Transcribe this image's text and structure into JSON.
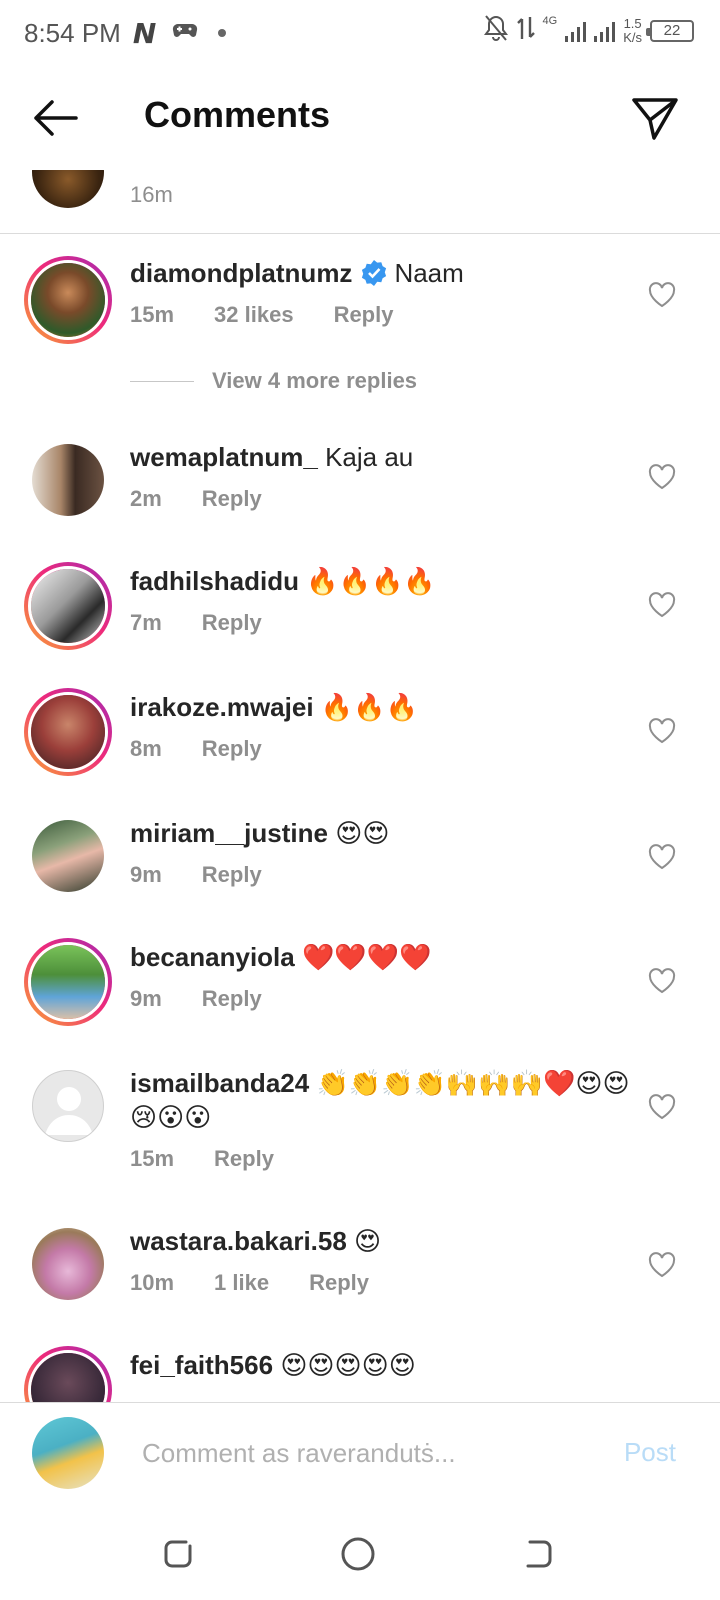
{
  "status": {
    "time": "8:54 PM",
    "app_badge": "N",
    "network": "4G",
    "speed_value": "1.5",
    "speed_unit": "K/s",
    "battery": "22"
  },
  "header": {
    "title": "Comments"
  },
  "top_partial": {
    "time": "16m"
  },
  "comments": [
    {
      "username": "diamondplatnumz",
      "verified": true,
      "text": "Naam",
      "time": "15m",
      "likes": "32 likes",
      "reply": "Reply"
    },
    {
      "username": "wemaplatnum_",
      "text": "Kaja au",
      "time": "2m",
      "reply": "Reply"
    },
    {
      "username": "fadhilshadidu",
      "text": "🔥🔥🔥🔥",
      "time": "7m",
      "reply": "Reply"
    },
    {
      "username": "irakoze.mwajei",
      "text": "🔥🔥🔥",
      "time": "8m",
      "reply": "Reply"
    },
    {
      "username": "miriam__justine",
      "text": "😍😍",
      "time": "9m",
      "reply": "Reply"
    },
    {
      "username": "becananyiola",
      "text": "❤️❤️❤️❤️",
      "time": "9m",
      "reply": "Reply"
    },
    {
      "username": "ismailbanda24",
      "text": "👏👏👏👏🙌🙌🙌❤️😍😍😢😮😮",
      "time": "15m",
      "reply": "Reply"
    },
    {
      "username": "wastara.bakari.58",
      "text": "😍",
      "time": "10m",
      "likes": "1 like",
      "reply": "Reply"
    },
    {
      "username": "fei_faith566",
      "text": "😍😍😍😍😍"
    }
  ],
  "view_replies": "View 4 more replies",
  "composer": {
    "placeholder": "Comment as raverandutṡ...",
    "post_label": "Post"
  },
  "colors": {
    "accent": "#0095f6",
    "post_disabled": "#b9dcf7",
    "verified": "#3897f0",
    "muted_text": "#8e8e8e"
  }
}
